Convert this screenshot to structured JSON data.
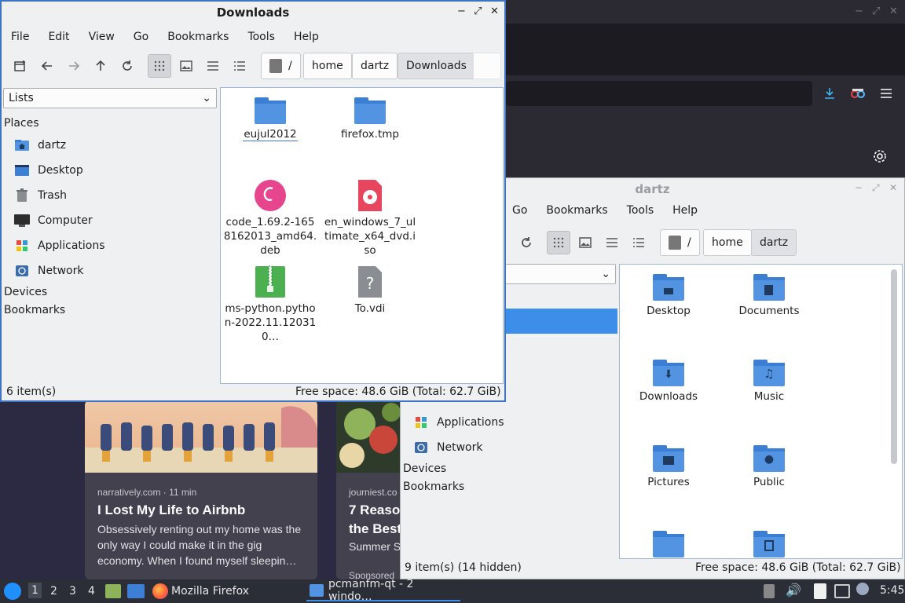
{
  "firefox": {
    "cards": [
      {
        "source": "narratively.com · 11 min",
        "title": "I Lost My Life to Airbnb",
        "desc": "Obsessively renting out my home was the only way I could make it in the gig economy. When I found myself sleepin…"
      },
      {
        "source": "journiest.co",
        "title": "7 Reaso",
        "title2": "the Best",
        "desc": "Summer S",
        "sponsored": "Sponsored"
      }
    ]
  },
  "downloads_window": {
    "title": "Downloads",
    "menu": [
      "File",
      "Edit",
      "View",
      "Go",
      "Bookmarks",
      "Tools",
      "Help"
    ],
    "breadcrumbs": [
      "/",
      "home",
      "dartz",
      "Downloads"
    ],
    "side_select": "Lists",
    "places_header": "Places",
    "places": [
      {
        "label": "dartz",
        "icon": "home-folder-icon"
      },
      {
        "label": "Desktop",
        "icon": "desktop-icon"
      },
      {
        "label": "Trash",
        "icon": "trash-icon"
      },
      {
        "label": "Computer",
        "icon": "computer-icon"
      },
      {
        "label": "Applications",
        "icon": "applications-icon"
      },
      {
        "label": "Network",
        "icon": "network-icon"
      }
    ],
    "devices_header": "Devices",
    "bookmarks_header": "Bookmarks",
    "files": [
      {
        "name": "eujul2012",
        "type": "folder"
      },
      {
        "name": "firefox.tmp",
        "type": "folder"
      },
      {
        "name": "code_1.69.2-1658162013_amd64.deb",
        "type": "debian"
      },
      {
        "name": "en_windows_7_ultimate_x64_dvd.iso",
        "type": "disc"
      },
      {
        "name": "ms-python.python-2022.11.120310…",
        "type": "archive"
      },
      {
        "name": "To.vdi",
        "type": "unknown"
      }
    ],
    "status_left": "6 item(s)",
    "status_right": "Free space: 48.6 GiB (Total: 62.7 GiB)"
  },
  "dartz_window": {
    "title": "dartz",
    "menu": [
      "Go",
      "Bookmarks",
      "Tools",
      "Help"
    ],
    "breadcrumbs": [
      "/",
      "home",
      "dartz"
    ],
    "places": [
      {
        "label": "Applications",
        "icon": "applications-icon"
      },
      {
        "label": "Network",
        "icon": "network-icon"
      }
    ],
    "devices_header": "Devices",
    "bookmarks_header": "Bookmarks",
    "files": [
      {
        "name": "Desktop",
        "emblem": "desktop"
      },
      {
        "name": "Documents",
        "emblem": "document"
      },
      {
        "name": "Downloads",
        "emblem": "download"
      },
      {
        "name": "Music",
        "emblem": "music"
      },
      {
        "name": "Pictures",
        "emblem": "picture"
      },
      {
        "name": "Public",
        "emblem": "user"
      },
      {
        "name": "",
        "emblem": "none"
      },
      {
        "name": "",
        "emblem": "template"
      }
    ],
    "status_left": "9 item(s) (14 hidden)",
    "status_right": "Free space: 48.6 GiB (Total: 62.7 GiB)"
  },
  "taskbar": {
    "workspaces": [
      "1",
      "2",
      "3",
      "4"
    ],
    "tasks": [
      "Mozilla Firefox",
      "pcmanfm-qt - 2 windo…"
    ],
    "clock": "5:45"
  }
}
